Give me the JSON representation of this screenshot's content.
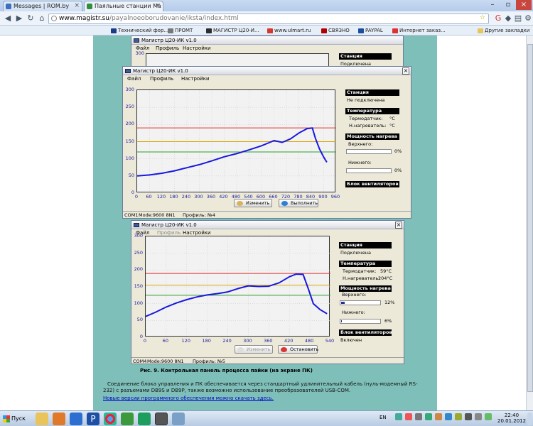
{
  "browser": {
    "tabs": [
      {
        "title": "Messages | ROM.by",
        "favicon_color": "#3b6fc2"
      },
      {
        "title": "Паяльные станции Ма",
        "favicon_color": "#2f8f3f"
      }
    ],
    "url_host": "www.magistr.su",
    "url_path": "/payalnoeoborudovanie/iksta/index.html",
    "bookmarks": [
      {
        "label": "Технический фор...",
        "color": "#1a3b8a"
      },
      {
        "label": "ПРОМТ",
        "color": "#777777"
      },
      {
        "label": "МАГИСТР Ц20-И...",
        "color": "#2c2c2c"
      },
      {
        "label": "www.ulmart.ru",
        "color": "#d8372b"
      },
      {
        "label": "СВЯЗНО",
        "color": "#b00000"
      },
      {
        "label": "PAYPAL",
        "color": "#1b4f9c"
      },
      {
        "label": "Интернет заказ...",
        "color": "#e03030"
      }
    ],
    "other_bookmarks": "Другие закладки"
  },
  "top_window": {
    "title": "Магистр Ц20-ИК v1.0",
    "menu": [
      "Файл",
      "Профиль",
      "Настройки"
    ],
    "ytick": "300",
    "station_header": "Станция",
    "station_status": "Подключена"
  },
  "win_a": {
    "title": "Магистр Ц20-ИК v1.0",
    "menu": [
      "Файл",
      "Профиль",
      "Настройки"
    ],
    "station_header": "Станция",
    "station_status": "Не подключена",
    "temp_header": "Температура",
    "thermocouple_label": "Термодатчик:",
    "thermocouple_value": "°C",
    "heater_label": "Н.нагреватель:",
    "heater_value": "°C",
    "power_header": "Мощность нагрева",
    "upper_label": "Верхнего:",
    "upper_value": "0%",
    "upper_level": 0,
    "lower_label": "Нижнего:",
    "lower_value": "0%",
    "lower_level": 0,
    "fan_header": "Блок вентиляторов",
    "fan_status": "",
    "btn_left": "Изменить",
    "btn_right": "Выполнить",
    "status_port": "COM1",
    "status_mode": "Mode:9600 8N1",
    "status_profile": "Профиль: №4"
  },
  "win_b": {
    "title": "Магистр Ц20-ИК v1.0",
    "menu": [
      "Файл",
      "Профиль",
      "Настройки"
    ],
    "station_header": "Станция",
    "station_status": "Подключена",
    "temp_header": "Температура",
    "thermocouple_label": "Термодатчик:",
    "thermocouple_value": "59°C",
    "heater_label": "Н.нагреватель:",
    "heater_value": "204°C",
    "power_header": "Мощность нагрева",
    "upper_label": "Верхнего:",
    "upper_value": "12%",
    "upper_level": 12,
    "lower_label": "Нижнего:",
    "lower_value": "6%",
    "lower_level": 6,
    "fan_header": "Блок вентиляторов",
    "fan_status": "Включен",
    "btn_left": "Изменить",
    "btn_right": "Остановить",
    "status_port": "COM4",
    "status_mode": "Mode:9600 8N1",
    "status_profile": "Профиль: №5"
  },
  "chart_data": [
    {
      "type": "line",
      "x_ticks": [
        "0",
        "60",
        "120",
        "180",
        "240",
        "300",
        "360",
        "420",
        "480",
        "540",
        "600",
        "660",
        "720",
        "780",
        "840",
        "900",
        "960"
      ],
      "y_ticks": [
        "0",
        "50",
        "100",
        "150",
        "200",
        "250",
        "300"
      ],
      "xlim": [
        0,
        960
      ],
      "ylim": [
        0,
        300
      ],
      "reference_lines": [
        {
          "y": 190,
          "color": "#e03030"
        },
        {
          "y": 150,
          "color": "#d9a400"
        },
        {
          "y": 120,
          "color": "#2e9e2e"
        }
      ],
      "series": [
        {
          "color": "#1818e0",
          "x": [
            0,
            60,
            120,
            180,
            240,
            300,
            360,
            420,
            480,
            540,
            600,
            640,
            660,
            700,
            740,
            780,
            820,
            845,
            860,
            880,
            900,
            915
          ],
          "y": [
            50,
            53,
            58,
            65,
            74,
            83,
            94,
            106,
            115,
            126,
            138,
            148,
            153,
            148,
            158,
            175,
            188,
            190,
            160,
            128,
            105,
            90
          ]
        }
      ]
    },
    {
      "type": "line",
      "x_ticks": [
        "0",
        "60",
        "120",
        "180",
        "240",
        "300",
        "360",
        "420",
        "480",
        "540"
      ],
      "y_ticks": [
        "0",
        "50",
        "100",
        "150",
        "200",
        "250",
        "300"
      ],
      "xlim": [
        0,
        540
      ],
      "ylim": [
        0,
        300
      ],
      "reference_lines": [
        {
          "y": 190,
          "color": "#e03030"
        },
        {
          "y": 155,
          "color": "#d9a400"
        },
        {
          "y": 125,
          "color": "#2e9e2e"
        }
      ],
      "series": [
        {
          "color": "#1818e0",
          "x": [
            0,
            30,
            60,
            90,
            120,
            150,
            180,
            210,
            240,
            270,
            300,
            330,
            360,
            390,
            420,
            440,
            460,
            475,
            490,
            510,
            530
          ],
          "y": [
            62,
            75,
            90,
            102,
            112,
            120,
            126,
            130,
            135,
            145,
            153,
            151,
            152,
            162,
            180,
            188,
            187,
            145,
            100,
            82,
            70
          ]
        }
      ]
    }
  ],
  "page": {
    "caption": "Рис. 9. Контрольная панель процесса пайки (на экране ПК)",
    "paragraph": "Соединение блока управления и ПК обеспечивается через стандартный удлинительный кабель (нуль-модемный RS-232) с разъемами DB9S и DB9P, также возможно использование преобразователей USB-COM.",
    "link": "Новые версии программного обеспечения можно скачать здесь."
  },
  "taskbar": {
    "start": "Пуск",
    "lang": "EN",
    "time": "22:40",
    "date": "20.01.2012"
  }
}
